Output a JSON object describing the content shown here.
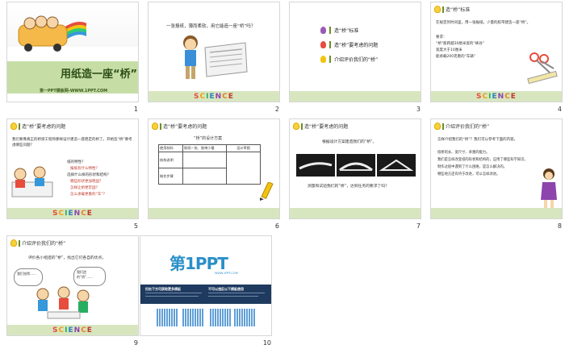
{
  "slides": [
    {
      "number": "1",
      "title": "用纸造一座“桥”",
      "subtitle": "第一PPT模板网-WWW.1PPT.COM"
    },
    {
      "number": "2",
      "text": "一张报纸，薄而柔软，用它能造一座“桥”吗？"
    },
    {
      "number": "3",
      "items": [
        "造“桥”标准",
        "造“桥”要考虑的问题",
        "介绍评价我们的“桥”"
      ]
    },
    {
      "number": "4",
      "header": "造“桥”标准",
      "intro": "在规定的时间里，用一张报纸，少量的胶带建造一座“桥”。",
      "req_title": "要求：",
      "reqs": [
        "“桥”能跨越30厘米宽的“峡谷”",
        "宽度大于10厘米",
        "能承载200克重的“车辆”"
      ]
    },
    {
      "number": "5",
      "header": "造“桥”要考虑的问题",
      "intro": "我们要像真正的桥梁工程师那样设计建造一座稳定的桥了。开始造“桥”要考虑哪些问题？",
      "bullets": [
        "纸的特性？",
        "报纸有什么特性？",
        "选择什么样的形状和结构？",
        "哪些形状更加稳固？",
        "怎样让桥更牢固？",
        "怎么承载更重的“车”？"
      ]
    },
    {
      "number": "6",
      "header": "造“桥”要考虑的问题",
      "table_title": "“桥”的设计方案",
      "cols": [
        "使用材料",
        "报纸一张、胶带少量",
        "设计草图"
      ],
      "rows": [
        "结构说明",
        "制作步骤"
      ]
    },
    {
      "number": "7",
      "header": "造“桥”要考虑的问题",
      "top": "根据设计方案建造我们的“桥”。",
      "bottom": "测量和试验我们的“桥”，达到任务的要求了吗？"
    },
    {
      "number": "8",
      "header": "介绍评价我们的“桥”",
      "intro": "怎样介绍我们的“桥”？我们可以参考下面的内容。",
      "bullets": [
        "纸桥的长、宽尺寸、承重的能力。",
        "我们是怎样改变纸的形状和结构的，应用了哪些科学知识。",
        "制作过程中遇到了什么困难，是怎么解决的。",
        "哪些地方还有待于改进，可以怎样改进。"
      ]
    },
    {
      "number": "9",
      "header": "介绍评价我们的“桥”",
      "intro": "评价各小组造的“桥”，找出它们各自的优点。",
      "bubble1": "我们觉得……",
      "bubble2": "我们造的“桥”……"
    },
    {
      "number": "10",
      "brand": "第1PPT",
      "site": "WWW.1PPT.COM",
      "col1_title": "扫右下方可获取更多模板",
      "col2_title": "不可以违反以下模板使用"
    }
  ],
  "science_word": [
    "S",
    "C",
    "I",
    "E",
    "N",
    "C",
    "E"
  ],
  "science_colors": [
    "#e74c3c",
    "#f39c12",
    "#27ae60",
    "#2980b9",
    "#8e44ad",
    "#e67e22",
    "#c0392b"
  ]
}
